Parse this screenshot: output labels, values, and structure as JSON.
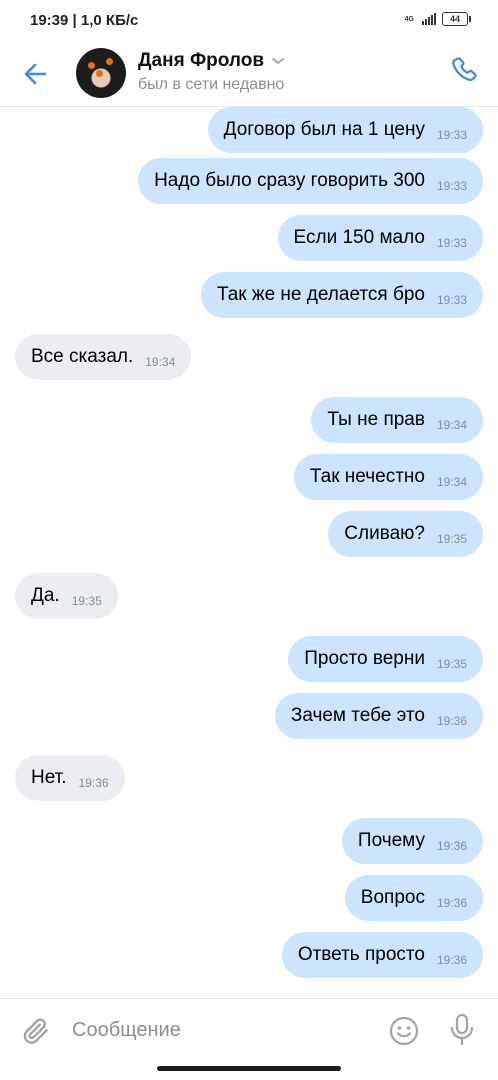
{
  "status_bar": {
    "time_speed": "19:39 | 1,0 КБ/с",
    "network": "4G",
    "battery": "44"
  },
  "header": {
    "name": "Даня Фролов",
    "status": "был в сети недавно"
  },
  "messages": [
    {
      "text": "Договор был на 1 цену",
      "time": "19:33",
      "direction": "out"
    },
    {
      "text": "Надо было сразу говорить 300",
      "time": "19:33",
      "direction": "out"
    },
    {
      "text": "Если 150 мало",
      "time": "19:33",
      "direction": "out"
    },
    {
      "text": "Так же не делается бро",
      "time": "19:33",
      "direction": "out"
    },
    {
      "text": "Все сказал.",
      "time": "19:34",
      "direction": "in"
    },
    {
      "text": "Ты не прав",
      "time": "19:34",
      "direction": "out"
    },
    {
      "text": "Так нечестно",
      "time": "19:34",
      "direction": "out"
    },
    {
      "text": "Сливаю?",
      "time": "19:35",
      "direction": "out"
    },
    {
      "text": "Да.",
      "time": "19:35",
      "direction": "in"
    },
    {
      "text": "Просто верни",
      "time": "19:35",
      "direction": "out"
    },
    {
      "text": "Зачем тебе это",
      "time": "19:36",
      "direction": "out"
    },
    {
      "text": "Нет.",
      "time": "19:36",
      "direction": "in"
    },
    {
      "text": "Почему",
      "time": "19:36",
      "direction": "out"
    },
    {
      "text": "Вопрос",
      "time": "19:36",
      "direction": "out"
    },
    {
      "text": "Ответь просто",
      "time": "19:36",
      "direction": "out"
    }
  ],
  "composer": {
    "placeholder": "Сообщение",
    "value": ""
  },
  "icons": {
    "back": "arrow-left-icon",
    "name_dropdown": "chevron-down-icon",
    "call": "phone-icon",
    "attach": "paperclip-icon",
    "emoji": "smile-icon",
    "voice": "microphone-icon"
  },
  "colors": {
    "accent": "#3f8ae0",
    "outgoing_bubble": "#cce4ff",
    "incoming_bubble": "#ebedf0",
    "secondary_text": "#818c99"
  }
}
